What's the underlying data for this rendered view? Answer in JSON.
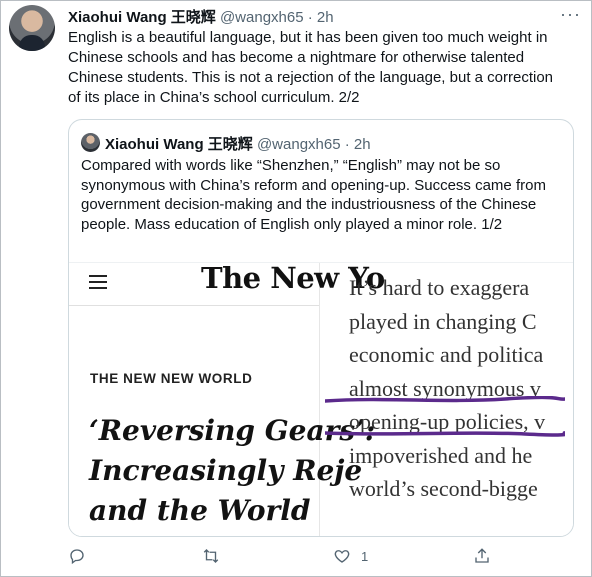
{
  "tweet": {
    "name": "Xiaohui Wang 王晓辉",
    "handle": "@wangxh65",
    "separator": "·",
    "time": "2h",
    "more": "···",
    "text": "English is a beautiful language, but it has been given too much weight in Chinese schools and has become a nightmare for otherwise talented Chinese students. This is not a rejection of the language, but a correction of its place in China’s school curriculum. 2/2"
  },
  "quoted": {
    "name": "Xiaohui Wang 王晓辉",
    "handle": "@wangxh65",
    "separator": "·",
    "time": "2h",
    "text": "Compared with words like “Shenzhen,” “English” may not be so synonymous with China’s reform and opening-up. Success came from government decision-making and the industriousness of the Chinese people. Mass education of English only played a minor role. 1/2",
    "media": {
      "masthead": "The New Yo",
      "kicker": "THE NEW NEW WORLD",
      "headline_lines": [
        "‘Reversing Gears’:",
        "Increasingly Reje",
        "and the World"
      ],
      "article_lines": [
        "It’s hard to exaggera",
        "played in changing C",
        "economic and politica",
        "almost synonymous v",
        "opening-up policies, v",
        "impoverished and he",
        "world’s second-bigge"
      ]
    }
  },
  "actions": {
    "reply_icon": "reply-icon",
    "retweet_icon": "retweet-icon",
    "like_icon": "heart-icon",
    "like_count": "1",
    "share_icon": "share-icon"
  },
  "colors": {
    "text": "#0f1419",
    "muted": "#536471",
    "border": "#cfd9de",
    "pen": "#5b2a8c"
  }
}
